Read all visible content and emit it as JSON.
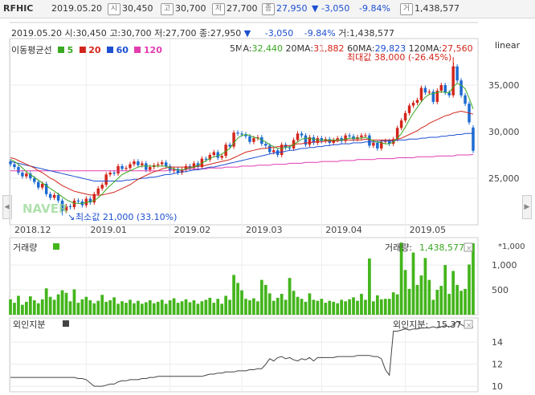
{
  "header": {
    "code": "RFHIC",
    "date": "2019.05.20",
    "open_tag": "시",
    "open": "30,450",
    "high_tag": "고",
    "high": "30,700",
    "low_tag": "저",
    "low": "27,700",
    "close_tag": "종",
    "close": "27,950",
    "change": "▼ -3,050",
    "change_pct": "-9.84%",
    "volume_tag": "거",
    "volume": "1,438,577"
  },
  "info": {
    "date": "2019.05.20",
    "open_label": "시:",
    "open": "30,450",
    "high_label": "고:",
    "high": "30,700",
    "low_label": "저:",
    "low": "27,700",
    "close_label": "종:",
    "close": "27,950",
    "change": "-3,050",
    "change_pct": "-9.84%",
    "volume_label": "거:",
    "volume": "1,438,577"
  },
  "ma_legend": {
    "title": "이동평균선",
    "p5": "5",
    "p20": "20",
    "p60": "60",
    "p120": "120",
    "ma5_label": "5MA:",
    "ma5": "32,440",
    "ma20_label": "20MA:",
    "ma20": "31,882",
    "ma60_label": "60MA:",
    "ma60": "29,823",
    "ma120_label": "120MA:",
    "ma120": "27,560",
    "scale": "linear"
  },
  "annotations": {
    "max": "최대값 38,000 (-26.45%)",
    "min": "최소값 21,000 (33.10%)",
    "watermark": "NAVER"
  },
  "colors": {
    "up": "#d3251b",
    "down": "#1d6bd1",
    "ma5": "#3aa822",
    "ma20": "#d3251b",
    "ma60": "#1d4fd1",
    "ma120": "#e23cb0",
    "volume": "#43b51c",
    "foreign": "#444444"
  },
  "volume_panel": {
    "title": "거래량",
    "value_label": "거래량:",
    "value": "1,438,577",
    "unit": "*1,000",
    "ticks": [
      "1,000",
      "500"
    ]
  },
  "foreign_panel": {
    "title": "외인지분",
    "value_label": "외인지분:",
    "value": "15.37",
    "ticks": [
      "14",
      "12",
      "10"
    ]
  },
  "chart_data": [
    {
      "type": "candlestick",
      "title": "",
      "x_labels": [
        "2018.12",
        "2019.01",
        "2019.02",
        "2019.03",
        "2019.04",
        "2019.05"
      ],
      "y_ticks": [
        25000,
        30000,
        35000
      ],
      "ylim": [
        20000,
        40000
      ],
      "scale": "linear",
      "close": [
        26500,
        26200,
        25600,
        25200,
        25500,
        25000,
        24600,
        24000,
        24400,
        23300,
        22900,
        23200,
        22600,
        21500,
        22000,
        21900,
        22600,
        22500,
        22100,
        22800,
        22400,
        23300,
        23900,
        24300,
        25400,
        25600,
        25500,
        26300,
        26000,
        26100,
        26500,
        26800,
        26400,
        26600,
        25900,
        26200,
        26400,
        26500,
        26700,
        26300,
        25800,
        26000,
        25600,
        25900,
        26300,
        26100,
        26600,
        26200,
        27100,
        27000,
        27500,
        27800,
        27200,
        27400,
        28600,
        28400,
        29900,
        29800,
        29700,
        29500,
        28900,
        29300,
        29400,
        28700,
        28500,
        27800,
        28000,
        27500,
        28600,
        28300,
        28200,
        29100,
        29800,
        29600,
        28600,
        29400,
        28800,
        29300,
        29000,
        29200,
        28800,
        29100,
        29300,
        29000,
        29600,
        29500,
        29200,
        29400,
        29600,
        29600,
        28500,
        28800,
        28200,
        28900,
        29000,
        28700,
        29200,
        30400,
        31200,
        32000,
        32800,
        33100,
        33400,
        34700,
        34200,
        34300,
        33200,
        34400,
        35000,
        34200,
        33900,
        37000,
        35500,
        33900,
        33000,
        31000,
        27950
      ],
      "ma5": [
        27000,
        26800,
        26500,
        26100,
        25700,
        25400,
        25100,
        24800,
        24500,
        24200,
        23900,
        23600,
        23300,
        23000,
        22700,
        22500,
        22300,
        22300,
        22300,
        22400,
        22500,
        22600,
        22900,
        23300,
        23800,
        24200,
        24600,
        25000,
        25400,
        25600,
        25800,
        26000,
        26200,
        26300,
        26300,
        26300,
        26300,
        26300,
        26300,
        26300,
        26100,
        26000,
        25900,
        25900,
        26000,
        26100,
        26200,
        26400,
        26600,
        26900,
        27100,
        27300,
        27400,
        27600,
        27900,
        28200,
        28800,
        29300,
        29600,
        29700,
        29600,
        29400,
        29300,
        29100,
        28900,
        28600,
        28400,
        28200,
        28200,
        28300,
        28400,
        28600,
        28900,
        29200,
        29300,
        29300,
        29200,
        29100,
        29100,
        29100,
        29100,
        29100,
        29100,
        29100,
        29200,
        29300,
        29300,
        29300,
        29300,
        29400,
        29200,
        29000,
        28900,
        28800,
        28700,
        28700,
        28900,
        29300,
        29800,
        30500,
        31300,
        32000,
        32600,
        33200,
        33700,
        34000,
        34100,
        34200,
        34300,
        34200,
        34200,
        34800,
        35200,
        35000,
        34600,
        33600,
        32440
      ],
      "ma20": [
        27200,
        27100,
        26900,
        26700,
        26500,
        26300,
        26100,
        25800,
        25600,
        25300,
        25000,
        24800,
        24500,
        24200,
        24000,
        23800,
        23600,
        23500,
        23400,
        23300,
        23200,
        23200,
        23200,
        23200,
        23300,
        23400,
        23500,
        23700,
        23900,
        24100,
        24300,
        24600,
        24900,
        25100,
        25300,
        25500,
        25700,
        25800,
        26000,
        26100,
        26200,
        26200,
        26200,
        26200,
        26200,
        26200,
        26200,
        26300,
        26300,
        26400,
        26500,
        26600,
        26700,
        26800,
        26900,
        27000,
        27200,
        27400,
        27600,
        27800,
        27900,
        28000,
        28100,
        28200,
        28200,
        28300,
        28300,
        28400,
        28400,
        28500,
        28500,
        28600,
        28700,
        28700,
        28800,
        28800,
        28900,
        28900,
        28900,
        29000,
        29000,
        29000,
        29000,
        29100,
        29100,
        29100,
        29100,
        29100,
        29100,
        29200,
        29100,
        29100,
        29100,
        29100,
        29100,
        29100,
        29100,
        29200,
        29300,
        29500,
        29700,
        29900,
        30100,
        30400,
        30600,
        30900,
        31100,
        31300,
        31500,
        31700,
        31800,
        32000,
        32100,
        32200,
        32100,
        32000,
        31882
      ],
      "ma60": [
        26800,
        26700,
        26600,
        26500,
        26400,
        26300,
        26200,
        26100,
        26000,
        25900,
        25800,
        25700,
        25600,
        25500,
        25400,
        25300,
        25200,
        25100,
        25000,
        24900,
        24800,
        24700,
        24700,
        24700,
        24700,
        24700,
        24700,
        24700,
        24700,
        24800,
        24800,
        24900,
        24900,
        25000,
        25000,
        25100,
        25100,
        25200,
        25300,
        25400,
        25400,
        25500,
        25600,
        25700,
        25700,
        25800,
        25900,
        25900,
        26000,
        26100,
        26200,
        26200,
        26300,
        26400,
        26500,
        26600,
        26700,
        26800,
        26900,
        27000,
        27100,
        27200,
        27300,
        27400,
        27500,
        27600,
        27700,
        27800,
        27800,
        27900,
        28000,
        28000,
        28100,
        28200,
        28200,
        28300,
        28300,
        28400,
        28400,
        28500,
        28500,
        28600,
        28600,
        28700,
        28700,
        28700,
        28800,
        28800,
        28800,
        28900,
        28900,
        28900,
        28900,
        29000,
        29000,
        29000,
        29000,
        29100,
        29100,
        29100,
        29200,
        29200,
        29200,
        29300,
        29300,
        29400,
        29400,
        29400,
        29500,
        29500,
        29600,
        29600,
        29700,
        29700,
        29800,
        29800,
        29823
      ],
      "ma120": [
        25800,
        25800,
        25800,
        25800,
        25800,
        25800,
        25800,
        25800,
        25800,
        25800,
        25800,
        25800,
        25800,
        25800,
        25800,
        25800,
        25800,
        25800,
        25800,
        25800,
        25800,
        25800,
        25800,
        25800,
        25800,
        25800,
        25800,
        25800,
        25800,
        25800,
        25800,
        25800,
        25800,
        25800,
        25800,
        25800,
        25800,
        25800,
        25800,
        25800,
        25900,
        25900,
        25900,
        25900,
        25900,
        26000,
        26000,
        26000,
        26000,
        26000,
        26100,
        26100,
        26100,
        26100,
        26200,
        26200,
        26200,
        26200,
        26300,
        26300,
        26300,
        26300,
        26400,
        26400,
        26400,
        26400,
        26500,
        26500,
        26500,
        26500,
        26600,
        26600,
        26600,
        26600,
        26700,
        26700,
        26700,
        26700,
        26800,
        26800,
        26800,
        26800,
        26800,
        26900,
        26900,
        26900,
        26900,
        27000,
        27000,
        27000,
        27000,
        27000,
        27100,
        27100,
        27100,
        27100,
        27100,
        27200,
        27200,
        27200,
        27200,
        27200,
        27300,
        27300,
        27300,
        27300,
        27300,
        27400,
        27400,
        27400,
        27400,
        27400,
        27500,
        27500,
        27500,
        27500,
        27560
      ],
      "max": {
        "value": 38000,
        "label": "최대값 38,000 (-26.45%)"
      },
      "min": {
        "value": 21000,
        "label": "최소값 21,000 (33.10%)"
      }
    },
    {
      "type": "bar",
      "title": "거래량",
      "y_ticks": [
        500,
        1000
      ],
      "ylim": [
        0,
        1550
      ],
      "values": [
        310,
        240,
        380,
        200,
        260,
        370,
        290,
        230,
        310,
        530,
        360,
        300,
        410,
        490,
        440,
        270,
        510,
        240,
        310,
        360,
        290,
        230,
        280,
        400,
        260,
        290,
        350,
        220,
        270,
        240,
        300,
        230,
        280,
        220,
        250,
        290,
        230,
        260,
        300,
        220,
        290,
        330,
        240,
        270,
        310,
        250,
        290,
        220,
        270,
        300,
        340,
        240,
        320,
        220,
        380,
        300,
        800,
        640,
        490,
        320,
        290,
        330,
        270,
        700,
        600,
        430,
        280,
        340,
        420,
        300,
        740,
        480,
        360,
        320,
        260,
        430,
        300,
        280,
        320,
        240,
        280,
        260,
        230,
        300,
        270,
        310,
        350,
        280,
        420,
        300,
        1130,
        270,
        390,
        310,
        320,
        320,
        450,
        410,
        1450,
        900,
        520,
        1250,
        600,
        790,
        1140,
        700,
        300,
        500,
        580,
        1000,
        420,
        880,
        600,
        480,
        520,
        1010,
        1438
      ]
    },
    {
      "type": "line",
      "title": "외인지분",
      "y_ticks": [
        10,
        12,
        14
      ],
      "ylim": [
        9.5,
        16.2
      ],
      "values": [
        10.8,
        10.8,
        10.8,
        10.8,
        10.8,
        10.8,
        10.8,
        10.8,
        10.8,
        10.8,
        10.8,
        10.8,
        10.8,
        10.8,
        10.8,
        10.8,
        10.8,
        10.7,
        10.7,
        10.6,
        10.3,
        10.0,
        10.0,
        10.0,
        10.1,
        10.2,
        10.2,
        10.4,
        10.5,
        10.5,
        10.6,
        10.6,
        10.6,
        10.7,
        10.7,
        10.8,
        10.8,
        10.9,
        10.9,
        10.9,
        10.9,
        10.9,
        10.9,
        10.9,
        10.9,
        10.9,
        10.9,
        10.9,
        10.9,
        11.0,
        11.1,
        11.1,
        11.2,
        11.2,
        11.3,
        11.3,
        11.3,
        11.4,
        11.4,
        11.4,
        11.5,
        11.5,
        11.6,
        11.6,
        12.0,
        12.5,
        12.3,
        12.6,
        12.7,
        12.5,
        12.6,
        12.4,
        12.3,
        12.5,
        12.4,
        12.6,
        12.3,
        12.6,
        12.6,
        12.6,
        12.6,
        12.6,
        12.7,
        12.7,
        12.7,
        12.7,
        12.7,
        12.8,
        12.8,
        12.8,
        12.8,
        12.7,
        12.7,
        12.5,
        11.5,
        11.0,
        15.0,
        15.0,
        15.1,
        15.2,
        15.1,
        15.2,
        15.2,
        15.3,
        15.3,
        15.3,
        15.4,
        15.3,
        15.4,
        15.5,
        15.4,
        15.5,
        15.9,
        15.6,
        15.4,
        15.4,
        15.37
      ]
    }
  ]
}
